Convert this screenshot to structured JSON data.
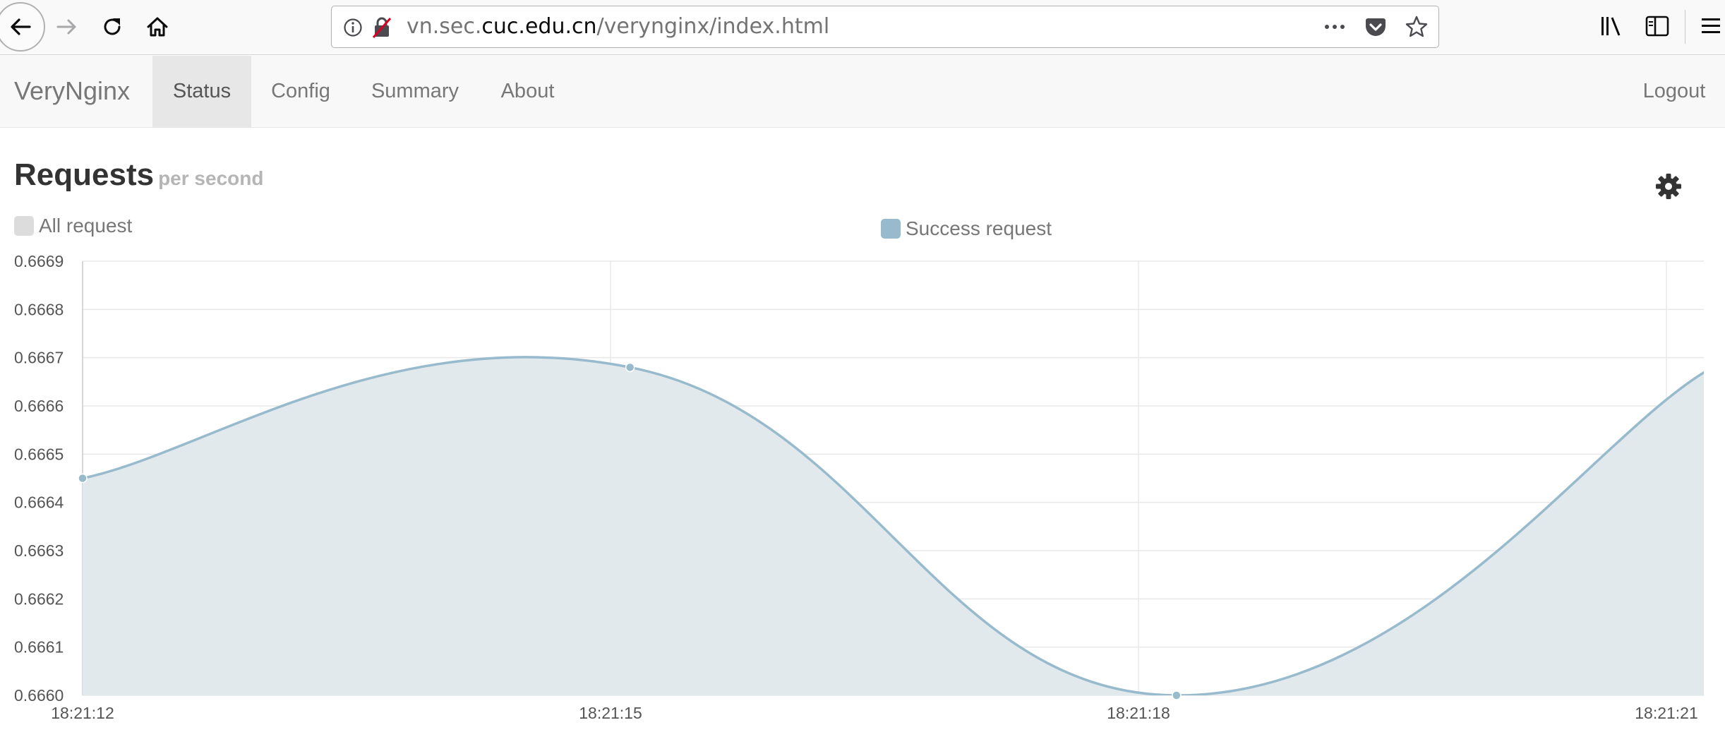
{
  "browser": {
    "url_prefix": "vn.sec.",
    "url_domain": "cuc.edu.cn",
    "url_path": "/verynginx/index.html",
    "icons": [
      "back-icon",
      "forward-icon",
      "reload-icon",
      "home-icon",
      "info-icon",
      "insecure-lock-icon",
      "more-icon",
      "pocket-icon",
      "bookmark-star-icon",
      "library-icon",
      "sidebar-icon",
      "menu-icon"
    ]
  },
  "navbar": {
    "brand": "VeryNginx",
    "items": [
      {
        "label": "Status",
        "active": true
      },
      {
        "label": "Config",
        "active": false
      },
      {
        "label": "Summary",
        "active": false
      },
      {
        "label": "About",
        "active": false
      }
    ],
    "logout": "Logout"
  },
  "section": {
    "title": "Requests",
    "subtitle": "per second",
    "settings_icon": "gear-icon"
  },
  "chart_data": {
    "type": "area",
    "x": [
      "18:21:12",
      "18:21:15",
      "18:21:18",
      "18:21:21"
    ],
    "ylim": [
      0.666,
      0.6669
    ],
    "yticks": [
      "0.6669",
      "0.6668",
      "0.6667",
      "0.6666",
      "0.6665",
      "0.6664",
      "0.6663",
      "0.6662",
      "0.6661",
      "0.6660"
    ],
    "grid": true,
    "legend_position": "top",
    "series": [
      {
        "name": "All request",
        "color": "#dcdcdc",
        "values": []
      },
      {
        "name": "Success request",
        "color": "#97bbcd",
        "x": [
          0,
          1.037,
          2.072,
          3.072
        ],
        "values": [
          0.66645,
          0.66668,
          0.666,
          0.66667
        ]
      }
    ]
  }
}
